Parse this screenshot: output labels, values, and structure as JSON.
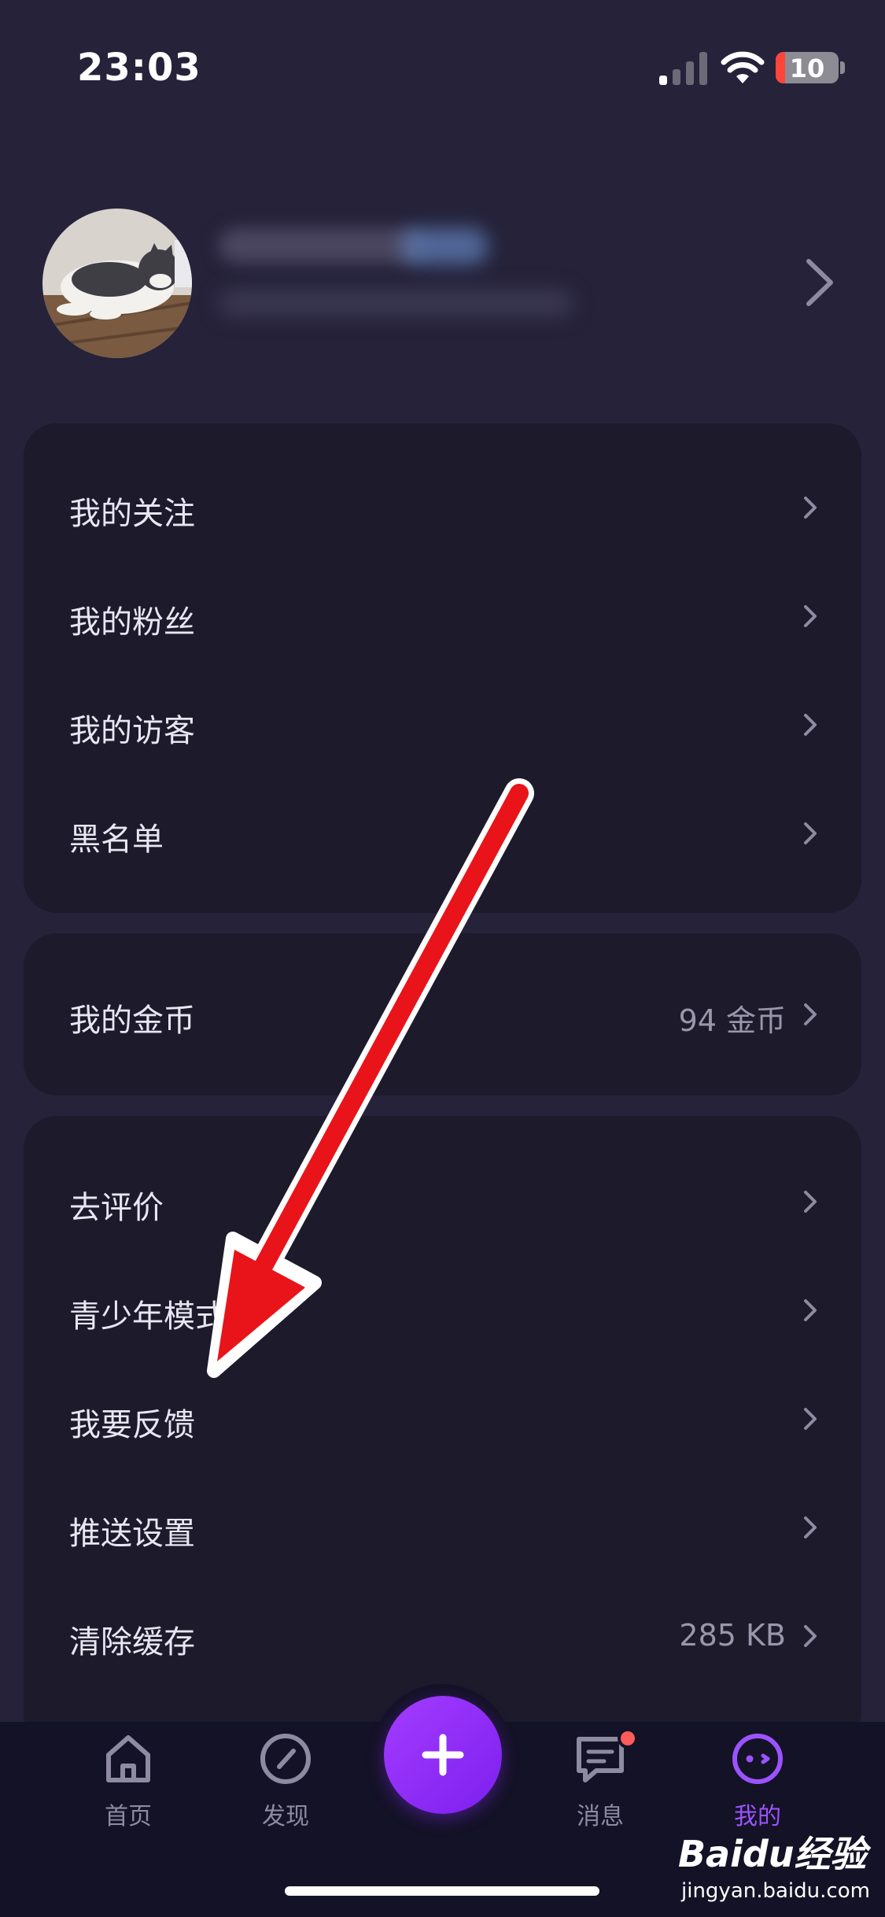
{
  "status_bar": {
    "time": "23:03",
    "battery_level": "10",
    "battery_low_color": "#ff453a"
  },
  "profile": {
    "avatar_icon": "cat-photo-avatar",
    "chevron_icon": "chevron-right-icon"
  },
  "menu_groups": [
    {
      "items": [
        {
          "label": "我的关注",
          "value": ""
        },
        {
          "label": "我的粉丝",
          "value": ""
        },
        {
          "label": "我的访客",
          "value": ""
        },
        {
          "label": "黑名单",
          "value": ""
        }
      ]
    },
    {
      "items": [
        {
          "label": "我的金币",
          "value": "94 金币"
        }
      ]
    },
    {
      "items": [
        {
          "label": "去评价",
          "value": ""
        },
        {
          "label": "青少年模式",
          "value": ""
        },
        {
          "label": "我要反馈",
          "value": ""
        },
        {
          "label": "推送设置",
          "value": ""
        },
        {
          "label": "清除缓存",
          "value": "285 KB"
        }
      ]
    }
  ],
  "tabbar": {
    "tabs": [
      {
        "label": "首页",
        "icon": "home-icon"
      },
      {
        "label": "发现",
        "icon": "compass-icon"
      },
      {
        "label": "消息",
        "icon": "message-icon",
        "badge": true
      },
      {
        "label": "我的",
        "icon": "profile-face-icon",
        "active": true
      }
    ],
    "fab_icon": "plus-icon",
    "accent_color": "#9b53ff"
  },
  "annotation": {
    "arrow_color": "#e8141a"
  },
  "watermark": {
    "brand": "Baidu经验",
    "url": "jingyan.baidu.com"
  }
}
